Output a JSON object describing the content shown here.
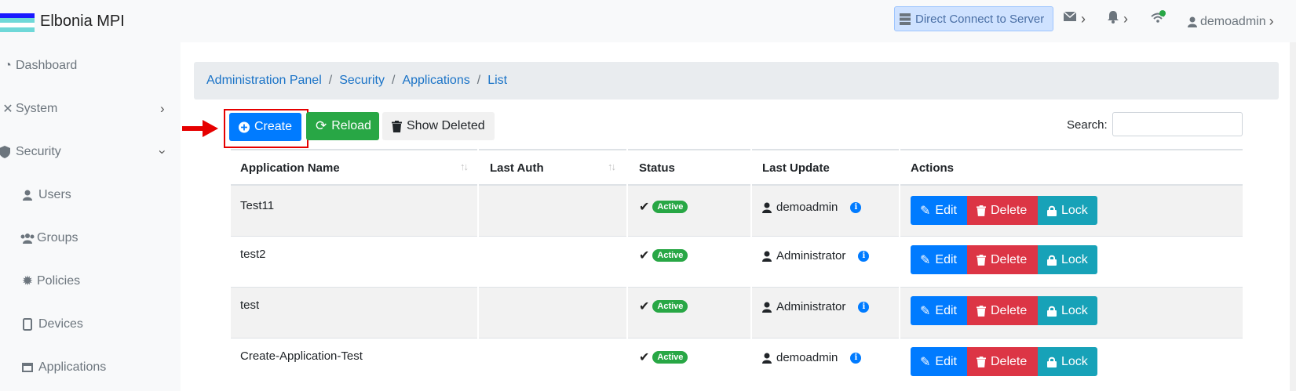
{
  "app": {
    "title": "Elbonia MPI"
  },
  "topbar": {
    "direct_connect": "Direct Connect to Server",
    "user": "demoadmin",
    "icons": [
      "server-icon",
      "envelope-icon",
      "bell-icon",
      "wifi-icon",
      "user-icon"
    ]
  },
  "sidebar": {
    "items": [
      {
        "label": "Dashboard",
        "icon": "dashboard-icon"
      },
      {
        "label": "System",
        "icon": "tools-icon"
      },
      {
        "label": "Security",
        "icon": "shield-icon"
      },
      {
        "label": "Users",
        "icon": "user-icon"
      },
      {
        "label": "Groups",
        "icon": "users-icon"
      },
      {
        "label": "Policies",
        "icon": "gear-icon"
      },
      {
        "label": "Devices",
        "icon": "tablet-icon"
      },
      {
        "label": "Applications",
        "icon": "window-icon"
      }
    ]
  },
  "breadcrumb": [
    "Administration Panel",
    "Security",
    "Applications",
    "List"
  ],
  "toolbar": {
    "create": "Create",
    "reload": "Reload",
    "show_deleted": "Show Deleted",
    "search_label": "Search:",
    "search_value": ""
  },
  "table": {
    "headers": [
      "Application Name",
      "Last Auth",
      "Status",
      "Last Update",
      "Actions"
    ],
    "actions": {
      "edit": "Edit",
      "delete": "Delete",
      "lock": "Lock"
    },
    "rows": [
      {
        "name": "Test11",
        "last_auth": "",
        "status": "Active",
        "updated_by": "demoadmin"
      },
      {
        "name": "test2",
        "last_auth": "",
        "status": "Active",
        "updated_by": "Administrator"
      },
      {
        "name": "test",
        "last_auth": "",
        "status": "Active",
        "updated_by": "Administrator"
      },
      {
        "name": "Create-Application-Test",
        "last_auth": "",
        "status": "Active",
        "updated_by": "demoadmin"
      }
    ]
  },
  "colors": {
    "primary": "#007bff",
    "success": "#28a745",
    "danger": "#dc3545",
    "info": "#17a2b8",
    "highlight": "#e60000"
  }
}
